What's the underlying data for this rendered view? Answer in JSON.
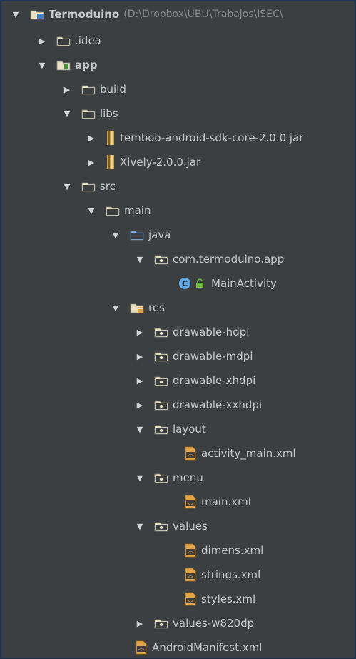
{
  "tree": {
    "root": {
      "label": "Termoduino",
      "path": "(D:\\Dropbox\\UBU\\Trabajos\\ISEC\\"
    },
    "idea": ".idea",
    "app": "app",
    "build": "build",
    "libs": "libs",
    "jar1": "temboo-android-sdk-core-2.0.0.jar",
    "jar2": "Xively-2.0.0.jar",
    "src": "src",
    "main": "main",
    "java": "java",
    "package": "com.termoduino.app",
    "main_activity": "MainActivity",
    "res": "res",
    "drawable_hdpi": "drawable-hdpi",
    "drawable_mdpi": "drawable-mdpi",
    "drawable_xhdpi": "drawable-xhdpi",
    "drawable_xxhdpi": "drawable-xxhdpi",
    "layout": "layout",
    "activity_main": "activity_main.xml",
    "menu": "menu",
    "main_xml": "main.xml",
    "values": "values",
    "dimens": "dimens.xml",
    "strings": "strings.xml",
    "styles": "styles.xml",
    "values_w820dp": "values-w820dp",
    "manifest": "AndroidManifest.xml"
  },
  "icons": {
    "folder": "folder-icon",
    "source_folder": "source-folder-icon",
    "module": "module-icon",
    "jar": "jar-icon",
    "xml": "xml-file-icon",
    "class": "class-icon",
    "res_folder": "resource-folder-icon"
  },
  "colors": {
    "background": "#3c3f41",
    "folder": "#e8e1c4",
    "source_folder": "#8cb6e0",
    "class": "#5fa9e6",
    "xml": "#e5a64b"
  }
}
